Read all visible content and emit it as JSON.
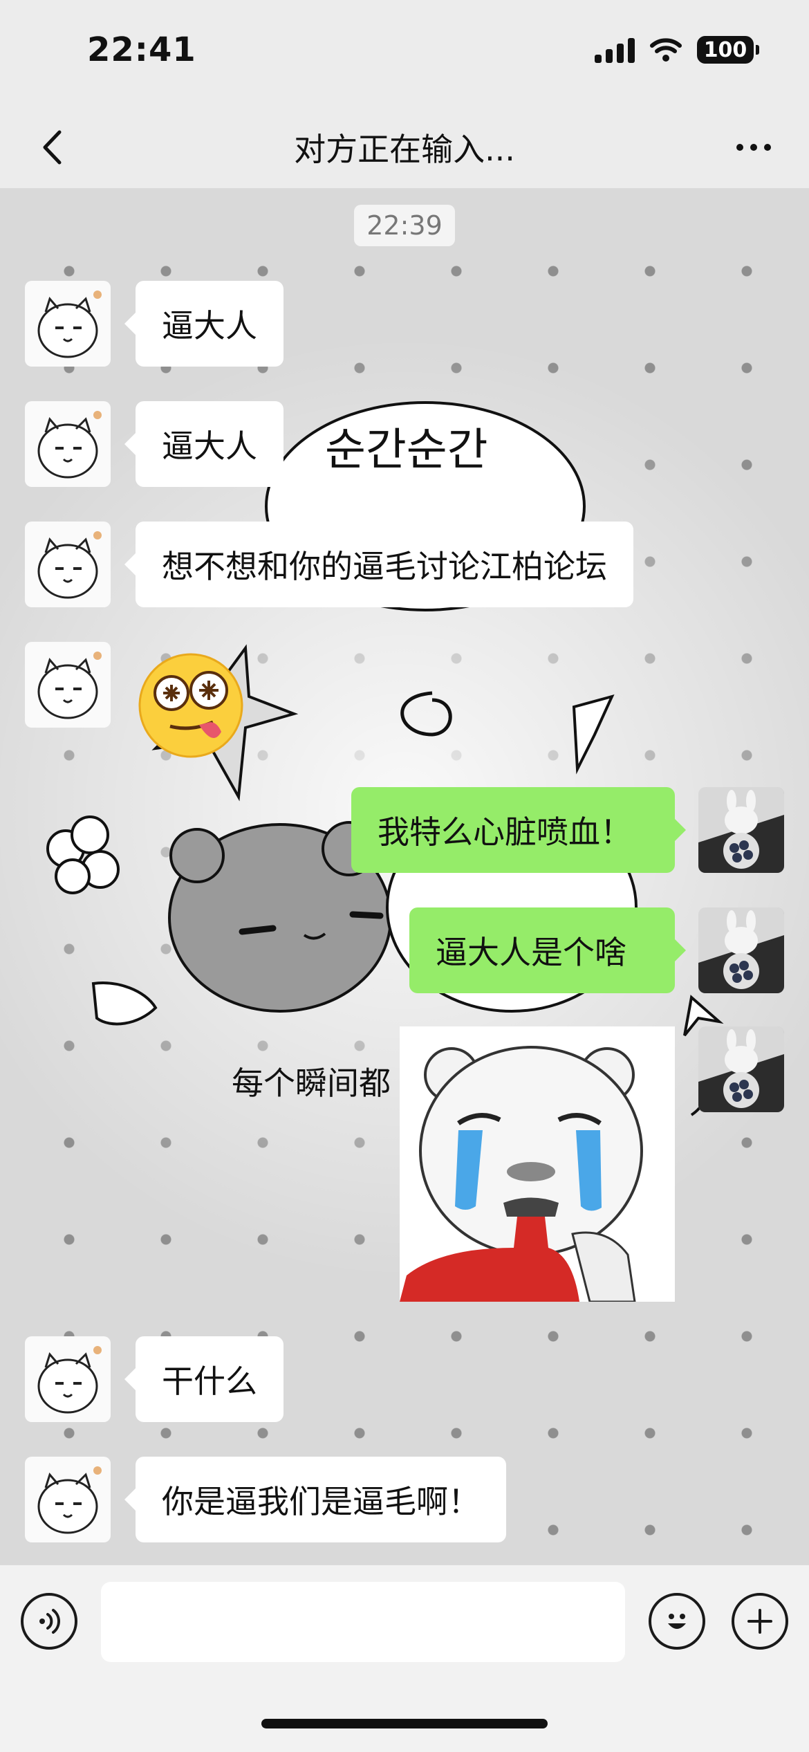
{
  "status_bar": {
    "time": "22:41",
    "battery": "100"
  },
  "nav": {
    "title": "对方正在输入..."
  },
  "chat": {
    "timestamp": "22:39",
    "messages": [
      {
        "side": "left",
        "type": "text",
        "text": "逼大人"
      },
      {
        "side": "left",
        "type": "text",
        "text": "逼大人"
      },
      {
        "side": "left",
        "type": "text",
        "text": "想不想和你的逼毛讨论江柏论坛"
      },
      {
        "side": "left",
        "type": "emoji",
        "icon": "drooling-starry-eyes-emoji-icon"
      },
      {
        "side": "right",
        "type": "text",
        "text": "我特么心脏喷血！"
      },
      {
        "side": "right",
        "type": "text",
        "text": "逼大人是个啥"
      },
      {
        "side": "right",
        "type": "sticker",
        "icon": "crying-bear-sticker"
      },
      {
        "side": "left",
        "type": "text",
        "text": "干什么"
      },
      {
        "side": "left",
        "type": "text",
        "text": "你是逼我们是逼毛啊！"
      }
    ]
  },
  "wallpaper": {
    "text_top": "순간순간",
    "text_bottom": "每个瞬间都"
  },
  "input_bar": {
    "input_value": ""
  },
  "colors": {
    "sent_bubble": "#95ec69",
    "received_bubble": "#ffffff",
    "background": "#ececec"
  }
}
